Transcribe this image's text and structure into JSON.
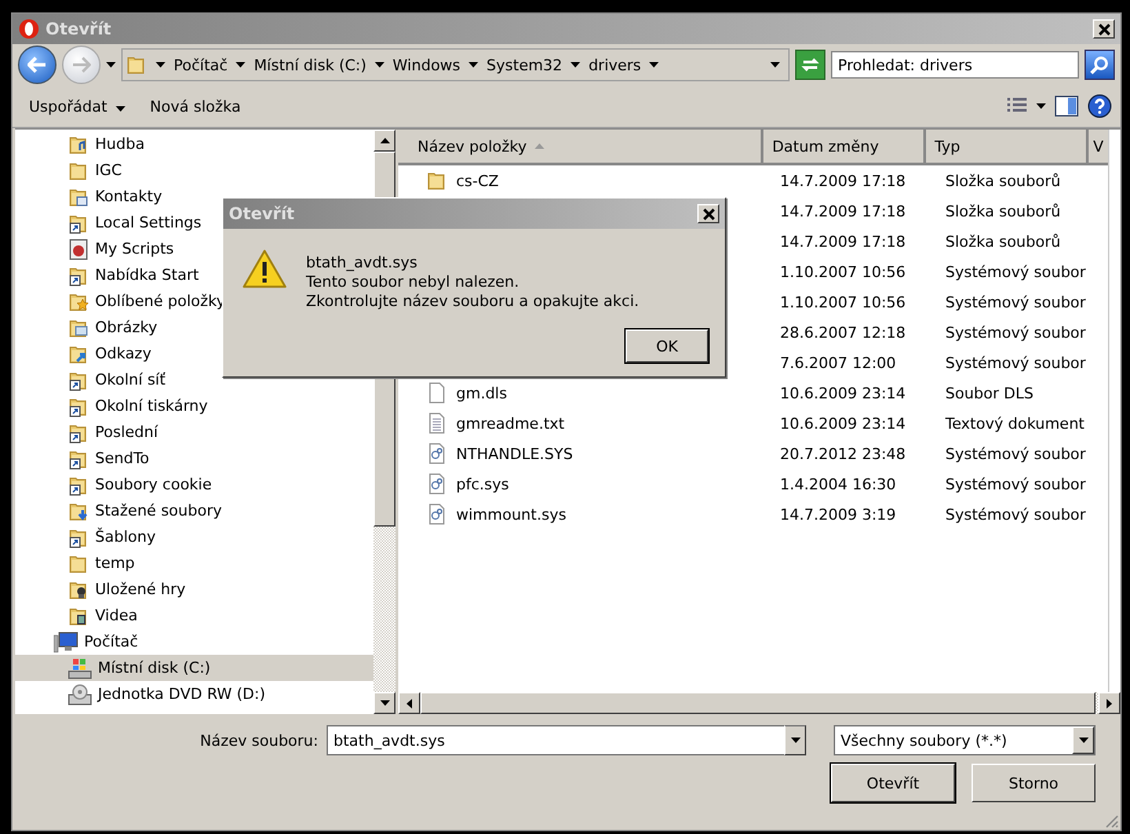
{
  "window": {
    "title": "Otevřít"
  },
  "address_bar": {
    "path": [
      "Počítač",
      "Místní disk (C:)",
      "Windows",
      "System32",
      "drivers"
    ]
  },
  "search": {
    "placeholder": "Prohledat: drivers"
  },
  "toolbar": {
    "buttons": [
      {
        "label": "Uspořádat",
        "kind": "menu"
      },
      {
        "label": "Nová složka",
        "kind": "plain"
      }
    ]
  },
  "tree": [
    {
      "children": [
        {
          "label": "Hudba",
          "kind": "music",
          "selected": false
        },
        {
          "label": "IGC",
          "kind": "folder",
          "selected": false
        },
        {
          "label": "Kontakty",
          "kind": "contacts",
          "selected": false
        },
        {
          "label": "Local Settings",
          "kind": "shortcut",
          "selected": false
        },
        {
          "label": "My Scripts",
          "kind": "script",
          "selected": false
        },
        {
          "label": "Nabídka Start",
          "kind": "shortcut",
          "selected": false
        },
        {
          "label": "Oblíbené položky",
          "kind": "star",
          "selected": false
        },
        {
          "label": "Obrázky",
          "kind": "pictures",
          "selected": false
        },
        {
          "label": "Odkazy",
          "kind": "links",
          "selected": false
        },
        {
          "label": "Okolní síť",
          "kind": "shortcut",
          "selected": false
        },
        {
          "label": "Okolní tiskárny",
          "kind": "shortcut",
          "selected": false
        },
        {
          "label": "Poslední",
          "kind": "shortcut",
          "selected": false
        },
        {
          "label": "SendTo",
          "kind": "shortcut",
          "selected": false
        },
        {
          "label": "Soubory cookie",
          "kind": "shortcut",
          "selected": false
        },
        {
          "label": "Stažené soubory",
          "kind": "download",
          "selected": false
        },
        {
          "label": "Šablony",
          "kind": "shortcut",
          "selected": false
        },
        {
          "label": "temp",
          "kind": "folder",
          "selected": false
        },
        {
          "label": "Uložené hry",
          "kind": "games",
          "selected": false
        },
        {
          "label": "Videa",
          "kind": "video",
          "selected": false
        }
      ]
    },
    {
      "label": "Počítač",
      "kind": "computer",
      "selected": false,
      "children": [
        {
          "label": "Místní disk (C:)",
          "kind": "drive",
          "selected": true
        },
        {
          "label": "Jednotka DVD RW (D:)",
          "kind": "dvd",
          "selected": false
        }
      ]
    }
  ],
  "table": {
    "columns": [
      "Název položky",
      "Datum změny",
      "Typ",
      "V"
    ],
    "rows": [
      {
        "name": "cs-CZ",
        "kind": "folder",
        "date": "14.7.2009 17:18",
        "type": "Složka souborů"
      },
      {
        "date": "14.7.2009 17:18",
        "type": "Složka souborů"
      },
      {
        "date": "14.7.2009 17:18",
        "type": "Složka souborů"
      },
      {
        "date": "1.10.2007 10:56",
        "type": "Systémový soubor"
      },
      {
        "date": "1.10.2007 10:56",
        "type": "Systémový soubor"
      },
      {
        "date": "28.6.2007 12:18",
        "type": "Systémový soubor"
      },
      {
        "date": "7.6.2007 12:00",
        "type": "Systémový soubor"
      },
      {
        "name": "gm.dls",
        "kind": "file",
        "date": "10.6.2009 23:14",
        "type": "Soubor DLS"
      },
      {
        "name": "gmreadme.txt",
        "kind": "text",
        "date": "10.6.2009 23:14",
        "type": "Textový dokument"
      },
      {
        "name": "NTHANDLE.SYS",
        "kind": "system",
        "date": "20.7.2012 23:48",
        "type": "Systémový soubor"
      },
      {
        "name": "pfc.sys",
        "kind": "system",
        "date": "1.4.2004 16:30",
        "type": "Systémový soubor"
      },
      {
        "name": "wimmount.sys",
        "kind": "system",
        "date": "14.7.2009 3:19",
        "type": "Systémový soubor"
      }
    ]
  },
  "footer": {
    "filename_label": "Název souboru:",
    "filename": "btath_avdt.sys",
    "filter": "Všechny soubory (*.*)",
    "buttons": [
      {
        "label": "Otevřít",
        "kind": "default"
      },
      {
        "label": "Storno",
        "kind": "normal"
      }
    ]
  },
  "alert": {
    "title": "Otevřít",
    "lines": [
      "btath_avdt.sys",
      "Tento soubor nebyl nalezen.",
      "Zkontrolujte název souboru a opakujte akci."
    ],
    "button": "OK"
  }
}
